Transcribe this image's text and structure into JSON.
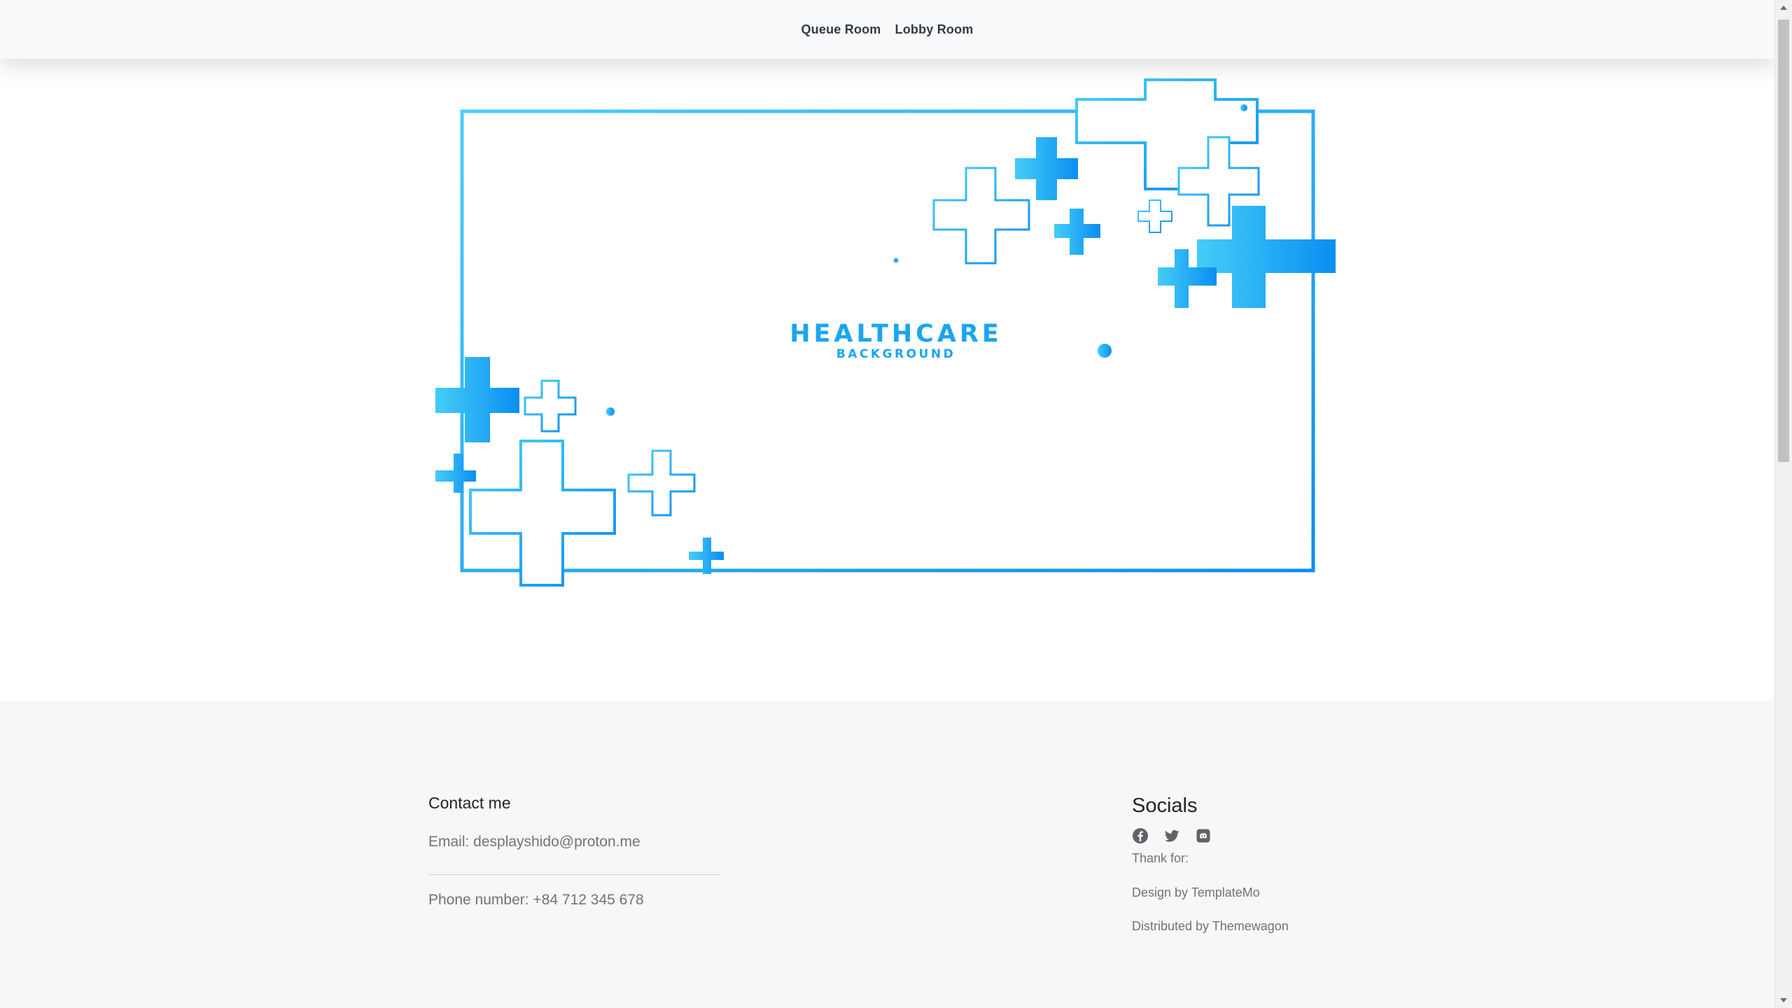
{
  "nav": {
    "links": [
      {
        "label": "Queue Room"
      },
      {
        "label": "Lobby Room"
      }
    ]
  },
  "hero": {
    "title": "HEALTHCARE",
    "subtitle": "BACKGROUND",
    "colors": {
      "light": "#45cdf7",
      "dark": "#0a8ef2"
    }
  },
  "footer": {
    "contact": {
      "heading": "Contact me",
      "email": "Email: desplayshido@proton.me",
      "phone": "Phone number: +84 712 345 678"
    },
    "socials": {
      "heading": "Socials",
      "icons": [
        "facebook-icon",
        "twitter-icon",
        "discord-icon"
      ],
      "thanks": "Thank for:",
      "design": "Design by TemplateMo",
      "distributed": "Distributed by Themewagon"
    }
  }
}
